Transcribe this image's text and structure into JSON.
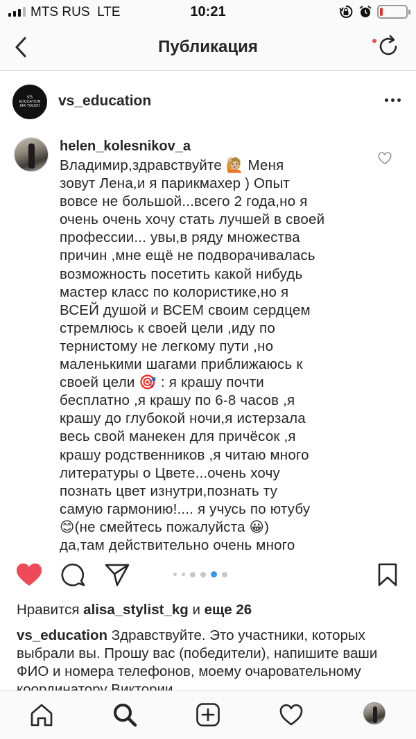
{
  "status_bar": {
    "carrier": "MTS RUS",
    "network": "LTE",
    "time": "10:21",
    "battery_level": 0.12,
    "battery_color": "#e0352b"
  },
  "nav": {
    "title": "Публикация",
    "back_icon": "chevron-left-icon",
    "refresh_icon": "refresh-icon"
  },
  "post": {
    "username": "vs_education",
    "avatar_text": [
      "VS",
      "EDUCATION",
      "AIR TOUCH"
    ]
  },
  "comment": {
    "username": "helen_kolesnikov_a",
    "text": "Владимир,здравствуйте 🙋🏼 Меня\nзовут Лена,и я парикмахер ) Опыт\nвовсе не большой...всего 2 года,но я\nочень очень хочу стать лучшей в своей\nпрофессии... увы,в ряду множества\nпричин ,мне ещё не подворачивалась\nвозможность посетить какой нибудь\nмастер класс по колористике,но я\nВСЕЙ душой и ВСЕМ своим сердцем\nстремлюсь к своей цели ,иду по\nтернистому не легкому пути ,но\nмаленькими шагами приближаюсь к\nсвоей цели 🎯 : я крашу почти\nбесплатно ,я крашу по 6-8 часов ,я\nкрашу до глубокой ночи,я истерзала\nвесь свой манекен для причёсок ,я\nкрашу родственников ,я читаю много\nлитературы о Цвете...очень хочу\nпознать цвет изнутри,познать ту\nсамую гармонию!.... я учусь по ютубу\n😊(не смейтесь пожалуйста 😀)\nда,там действительно очень много"
  },
  "actions": {
    "liked": true,
    "like_color": "#ed4956",
    "carousel_total": 6,
    "carousel_active": 5,
    "active_dot_color": "#3897f0"
  },
  "likes": {
    "prefix": "Нравится",
    "user": "alisa_stylist_kg",
    "connector": "и",
    "others": "еще 26"
  },
  "caption": {
    "username": "vs_education",
    "text": "Здравствуйте. Это участники, которых выбрали вы. Прошу вас (победители), напишите ваши ФИО и номера телефонов, моему очаровательному координатору Виктории"
  },
  "tab_bar": {
    "items": [
      "home-icon",
      "search-icon",
      "new-post-icon",
      "activity-icon",
      "profile-avatar"
    ],
    "active": "search-icon"
  }
}
